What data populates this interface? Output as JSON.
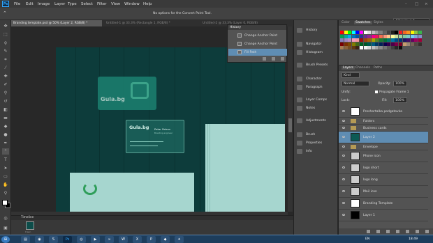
{
  "app": {
    "logo_text": "Ps"
  },
  "menu": [
    "File",
    "Edit",
    "Image",
    "Layer",
    "Type",
    "Select",
    "Filter",
    "View",
    "Window",
    "Help"
  ],
  "options_bar": {
    "message": "No options for the Convert Point Tool."
  },
  "workspace": {
    "value": "Sites layout"
  },
  "doc_tabs": [
    {
      "label": "Branding template.psd @ 50% (Layer 2, RGB/8) *",
      "active": true
    },
    {
      "label": "Untitled-1 @ 33.3% (Rectangle 1, RGB/8) *",
      "active": false
    },
    {
      "label": "Untitled-2 @ 33.3% (Layer 0, RGB/8)",
      "active": false
    }
  ],
  "history": {
    "title": "History",
    "items": [
      "Change Anchor Point",
      "Change Anchor Point",
      "Fill Path"
    ],
    "selected_index": 2
  },
  "dock": [
    {
      "label": "History",
      "icon": "history-icon"
    },
    {
      "label": "Navigator",
      "icon": "navigator-icon"
    },
    {
      "label": "Histogram",
      "icon": "histogram-icon"
    },
    {
      "label": "Brush Presets",
      "icon": "brush-presets-icon"
    },
    {
      "label": "Character",
      "icon": "character-icon"
    },
    {
      "label": "Paragraph",
      "icon": "paragraph-icon"
    },
    {
      "label": "Layer Comps",
      "icon": "layer-comps-icon"
    },
    {
      "label": "Notes",
      "icon": "notes-icon"
    },
    {
      "label": "Adjustments",
      "icon": "adjustments-icon"
    },
    {
      "label": "Brush",
      "icon": "brush-icon"
    },
    {
      "label": "Properties",
      "icon": "properties-icon"
    },
    {
      "label": "Info",
      "icon": "info-icon"
    }
  ],
  "swatch_panel": {
    "tabs": [
      "Color",
      "Swatches",
      "Styles"
    ],
    "active": "Swatches"
  },
  "layers_panel": {
    "tabs": [
      "Layers",
      "Channels",
      "Paths"
    ],
    "kind": "Kind",
    "blend_mode": "Normal",
    "opacity_label": "Opacity:",
    "opacity": "100%",
    "unify_label": "Unify:",
    "propagate_label": "Propagate Frame 1",
    "lock_label": "Lock:",
    "fill_label": "Fill:",
    "fill": "100%",
    "layers": [
      {
        "name": "Preshortalka podgatovka",
        "type": "layer",
        "thumb": "#ffffff",
        "selected": false
      },
      {
        "name": "Folders",
        "type": "group",
        "selected": false
      },
      {
        "name": "Business cards",
        "type": "group",
        "selected": false
      },
      {
        "name": "Layer 2",
        "type": "layer",
        "thumb": "#0d5a55",
        "selected": true
      },
      {
        "name": "Envelope",
        "type": "group",
        "selected": false
      },
      {
        "name": "Phone icon",
        "type": "layer",
        "thumb": "#cccccc",
        "selected": false
      },
      {
        "name": "logo short",
        "type": "layer",
        "thumb": "#cccccc",
        "selected": false
      },
      {
        "name": "logo long",
        "type": "layer",
        "thumb": "#cccccc",
        "selected": false
      },
      {
        "name": "Mail icon",
        "type": "layer",
        "thumb": "#cccccc",
        "selected": false
      },
      {
        "name": "Branding Template",
        "type": "layer",
        "thumb": "#ffffff",
        "selected": false
      },
      {
        "name": "Layer 1",
        "type": "layer",
        "thumb": "#000000",
        "selected": false
      }
    ]
  },
  "canvas": {
    "logo_text": "Gula.bg",
    "card_name": "Petar Petrov",
    "card_title": "Branding engineer",
    "brand_color": "#2f9e8a",
    "bg_color": "#0d3c3b"
  },
  "timeline": {
    "title": "Timeline",
    "frame_delay": "0 sec."
  },
  "taskbar": {
    "lang": "EN",
    "time": "18:49"
  },
  "colors": {
    "accent": "#5f8db3",
    "panel": "#535353"
  }
}
